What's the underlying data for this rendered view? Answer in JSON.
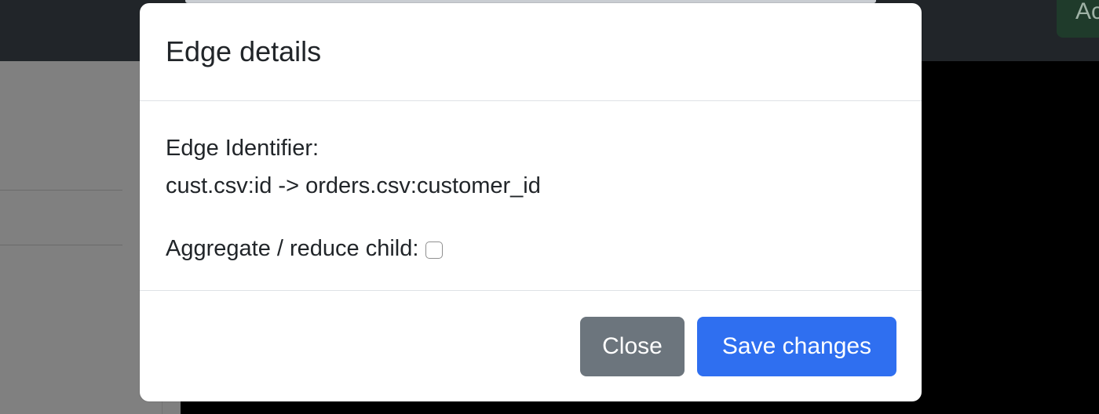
{
  "background": {
    "top_button_label": "Ac"
  },
  "modal": {
    "title": "Edge details",
    "edge_identifier_label": "Edge Identifier:",
    "edge_identifier_value": "cust.csv:id -> orders.csv:customer_id",
    "aggregate_label": "Aggregate / reduce child:",
    "aggregate_checked": false,
    "close_label": "Close",
    "save_label": "Save changes"
  },
  "colors": {
    "primary": "#2f6ff0",
    "secondary": "#6c757d",
    "text": "#212529",
    "topbar": "#212529"
  }
}
